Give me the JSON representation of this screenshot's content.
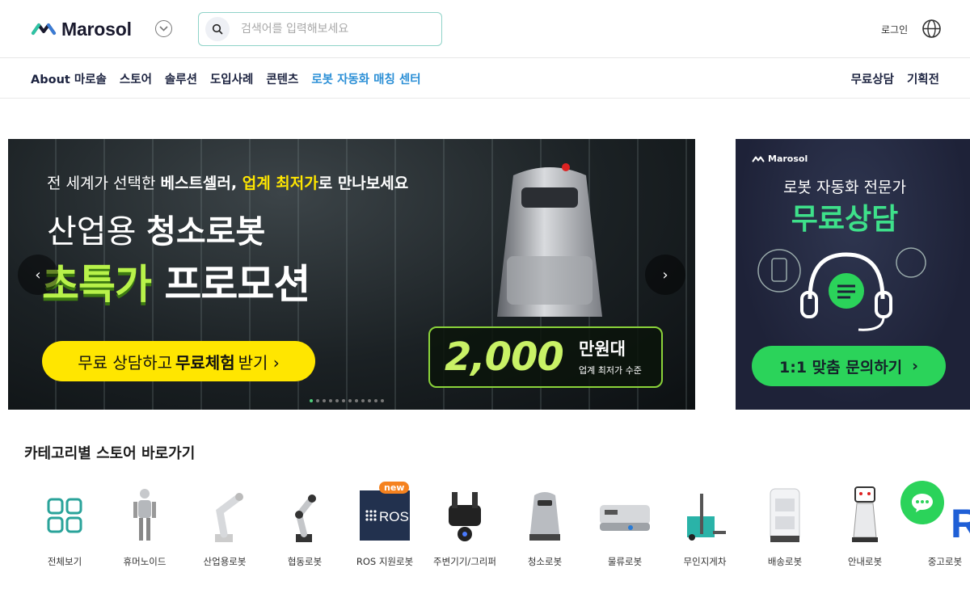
{
  "header": {
    "brand": "Marosol",
    "search_placeholder": "검색어를 입력해보세요",
    "login": "로그인"
  },
  "nav": {
    "left": [
      "About 마로솔",
      "스토어",
      "솔루션",
      "도입사례",
      "콘텐츠",
      "로봇 자동화 매칭 센터"
    ],
    "right": [
      "무료상담",
      "기획전"
    ]
  },
  "banner": {
    "sub_prefix": "전 세계가 선택한 ",
    "sub_bold": "베스트셀러, ",
    "sub_hl": "업계 최저가",
    "sub_suffix": "로 만나보세요",
    "line1_normal": "산업용 ",
    "line1_bold": "청소로봇",
    "line2_green": "초특가",
    "line2_white": " 프로모션",
    "cta_prefix": "무료 상담하고 ",
    "cta_bold": "무료체험",
    "cta_suffix": " 받기 ›",
    "price_num": "2,000",
    "price_unit": "만원대",
    "price_note": "업계 최저가 수준",
    "slide_count": 12,
    "active_slide": 0
  },
  "side_ad": {
    "brand": "Marosol",
    "line1": "로봇 자동화 전문가",
    "line2": "무료상담",
    "cta": "1:1 맞춤 문의하기",
    "cta_arrow": "›"
  },
  "categories": {
    "title": "카테고리별 스토어 바로가기",
    "new_badge": "new",
    "ros_text": "ROS",
    "items": [
      "전체보기",
      "휴머노이드",
      "산업용로봇",
      "협동로봇",
      "ROS 지원로봇",
      "주변기기/그리퍼",
      "청소로봇",
      "물류로봇",
      "무인지게차",
      "배송로봇",
      "안내로봇",
      "중고로봇"
    ]
  },
  "colors": {
    "accent_nav": "#2b8fd6",
    "banner_yellow": "#ffe600",
    "banner_green": "#b8f24a",
    "side_green": "#3ee08a",
    "chat_green": "#2bd35a",
    "badge_orange": "#f5821f"
  },
  "icons": [
    "logo-mark-icon",
    "chevron-down-icon",
    "search-icon",
    "globe-icon",
    "arrow-left-icon",
    "arrow-right-icon",
    "chat-icon",
    "headset-icon"
  ]
}
